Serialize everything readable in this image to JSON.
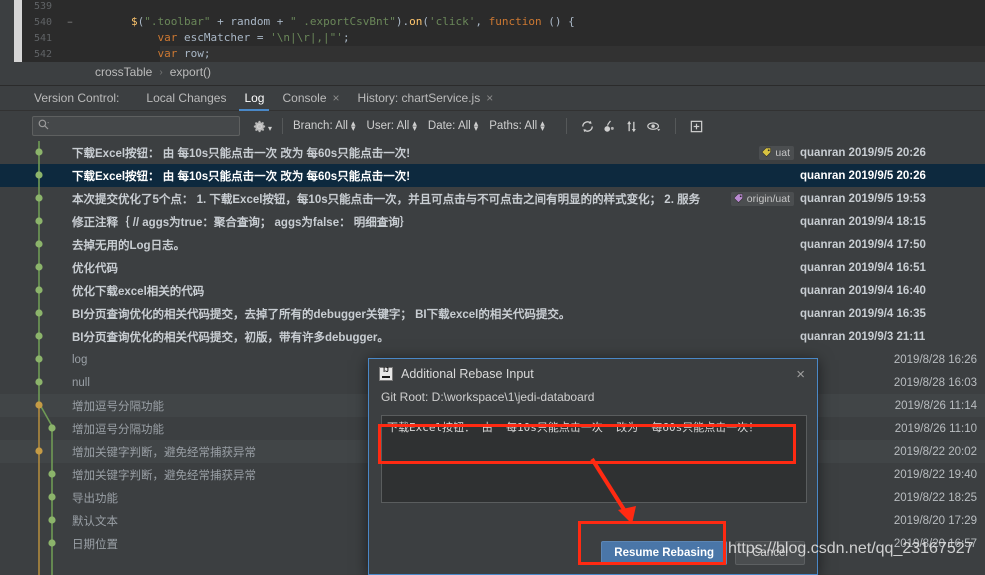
{
  "editor": {
    "lines": [
      {
        "num": "539",
        "fold": "",
        "segments": []
      },
      {
        "num": "540",
        "fold": "−",
        "segments": [
          {
            "t": "        ",
            "c": "tok-plain"
          },
          {
            "t": "$",
            "c": "tok-dollar"
          },
          {
            "t": "(",
            "c": "tok-plain"
          },
          {
            "t": "\".toolbar\"",
            "c": "tok-str"
          },
          {
            "t": " + random + ",
            "c": "tok-plain"
          },
          {
            "t": "\" .exportCsvBnt\"",
            "c": "tok-str"
          },
          {
            "t": ").",
            "c": "tok-plain"
          },
          {
            "t": "on",
            "c": "tok-fn"
          },
          {
            "t": "(",
            "c": "tok-plain"
          },
          {
            "t": "'click'",
            "c": "tok-str"
          },
          {
            "t": ", ",
            "c": "tok-plain"
          },
          {
            "t": "function",
            "c": "tok-kw"
          },
          {
            "t": " () {",
            "c": "tok-plain"
          }
        ]
      },
      {
        "num": "541",
        "fold": "",
        "segments": [
          {
            "t": "            ",
            "c": "tok-plain"
          },
          {
            "t": "var",
            "c": "tok-kw"
          },
          {
            "t": " escMatcher = ",
            "c": "tok-plain"
          },
          {
            "t": "'\\n|\\r|,|\"'",
            "c": "tok-str"
          },
          {
            "t": ";",
            "c": "tok-plain"
          }
        ]
      },
      {
        "num": "542",
        "fold": "",
        "segments": [
          {
            "t": "            ",
            "c": "tok-plain"
          },
          {
            "t": "var",
            "c": "tok-kw"
          },
          {
            "t": " row;",
            "c": "tok-plain"
          }
        ]
      }
    ]
  },
  "breadcrumb": {
    "class_name": "crossTable",
    "separator": "›",
    "method_name": "export()"
  },
  "toolwindow": {
    "label": "Version Control:",
    "tabs": [
      {
        "label": "Local Changes",
        "active": false,
        "closable": false
      },
      {
        "label": "Log",
        "active": true,
        "closable": false
      },
      {
        "label": "Console",
        "active": false,
        "closable": true
      },
      {
        "label": "History: chartService.js",
        "active": false,
        "closable": true
      }
    ],
    "close_glyph": "×"
  },
  "filterbar": {
    "search_placeholder": "",
    "search_value": "",
    "search_icon": "search-icon",
    "gear_icon": "gear-icon",
    "filters": [
      {
        "label": "Branch: All"
      },
      {
        "label": "User: All"
      },
      {
        "label": "Date: All"
      },
      {
        "label": "Paths: All"
      }
    ],
    "actions": [
      {
        "name": "refresh-icon",
        "glyph": "↻"
      },
      {
        "name": "cherry-pick-icon",
        "glyph": "⚘"
      },
      {
        "name": "sort-icon",
        "glyph": "⇅"
      },
      {
        "name": "show-details-icon",
        "glyph": "◉"
      },
      {
        "name": "add-tab-icon",
        "glyph": "⊞"
      }
    ]
  },
  "commits": [
    {
      "subject": "下载Excel按钮： 由 每10s只能点击一次 改为 每60s只能点击一次!",
      "author": "quanran 2019/9/5 20:26",
      "bold": true,
      "selected": false,
      "alt": false,
      "tags": [
        {
          "text": "uat",
          "kind": "tag"
        }
      ]
    },
    {
      "subject": "下载Excel按钮： 由 每10s只能点击一次 改为 每60s只能点击一次!",
      "author": "quanran 2019/9/5 20:26",
      "bold": true,
      "selected": true,
      "alt": false,
      "tags": []
    },
    {
      "subject": "本次提交优化了5个点： 1. 下载Excel按钮，每10s只能点击一次，并且可点击与不可点击之间有明显的的样式变化； 2. 服务",
      "author": "quanran 2019/9/5 19:53",
      "bold": true,
      "selected": false,
      "alt": false,
      "tags": [
        {
          "text": "origin/uat",
          "kind": "branch"
        }
      ]
    },
    {
      "subject": "修正注释｛   // aggs为true：聚合查询； aggs为false： 明细查询｝",
      "author": "quanran 2019/9/4 18:15",
      "bold": true,
      "selected": false,
      "alt": false,
      "tags": []
    },
    {
      "subject": "去掉无用的Log日志。",
      "author": "quanran 2019/9/4 17:50",
      "bold": true,
      "selected": false,
      "alt": false,
      "tags": []
    },
    {
      "subject": "优化代码",
      "author": "quanran 2019/9/4 16:51",
      "bold": true,
      "selected": false,
      "alt": false,
      "tags": []
    },
    {
      "subject": "优化下载excel相关的代码",
      "author": "quanran 2019/9/4 16:40",
      "bold": true,
      "selected": false,
      "alt": false,
      "tags": []
    },
    {
      "subject": "BI分页查询优化的相关代码提交，去掉了所有的debugger关键字； BI下载excel的相关代码提交。",
      "author": "quanran 2019/9/4 16:35",
      "bold": true,
      "selected": false,
      "alt": false,
      "tags": []
    },
    {
      "subject": "BI分页查询优化的相关代码提交，初版，带有许多debugger。",
      "author": "quanran 2019/9/3 21:11",
      "bold": true,
      "selected": false,
      "alt": false,
      "tags": []
    },
    {
      "subject": "log",
      "author": "2019/8/28 16:26",
      "bold": false,
      "selected": false,
      "alt": false,
      "tags": []
    },
    {
      "subject": "null",
      "author": "2019/8/28 16:03",
      "bold": false,
      "selected": false,
      "alt": false,
      "tags": []
    },
    {
      "subject": "增加逗号分隔功能",
      "author": "2019/8/26 11:14",
      "bold": false,
      "selected": false,
      "alt": true,
      "tags": []
    },
    {
      "subject": "增加逗号分隔功能",
      "author": "2019/8/26 11:10",
      "bold": false,
      "selected": false,
      "alt": false,
      "tags": []
    },
    {
      "subject": "增加关键字判断，避免经常捕获异常",
      "author": "2019/8/22 20:02",
      "bold": false,
      "selected": false,
      "alt": true,
      "tags": []
    },
    {
      "subject": "增加关键字判断，避免经常捕获异常",
      "author": "2019/8/22 19:40",
      "bold": false,
      "selected": false,
      "alt": false,
      "tags": []
    },
    {
      "subject": "导出功能",
      "author": "2019/8/22 18:25",
      "bold": false,
      "selected": false,
      "alt": false,
      "tags": []
    },
    {
      "subject": "默认文本",
      "author": "2019/8/20 17:29",
      "bold": false,
      "selected": false,
      "alt": false,
      "tags": []
    },
    {
      "subject": "日期位置",
      "author": "2019/8/20 16:57",
      "bold": false,
      "selected": false,
      "alt": false,
      "tags": []
    }
  ],
  "dialog": {
    "title": "Additional Rebase Input",
    "logo_name": "intellij-idea-icon",
    "close_glyph": "×",
    "git_root_label": "Git Root: D:\\workspace\\1\\jedi-databoard",
    "message_value": "下载Excel按钮： 由  每10s只能点击一次  改为  每60s只能点击一次！",
    "resume_button": "Resume Rebasing",
    "cancel_button": "Cancel"
  },
  "annotations": {
    "watermark": "https://blog.csdn.net/qq_23167527",
    "highlight_color": "#ff2a12"
  }
}
